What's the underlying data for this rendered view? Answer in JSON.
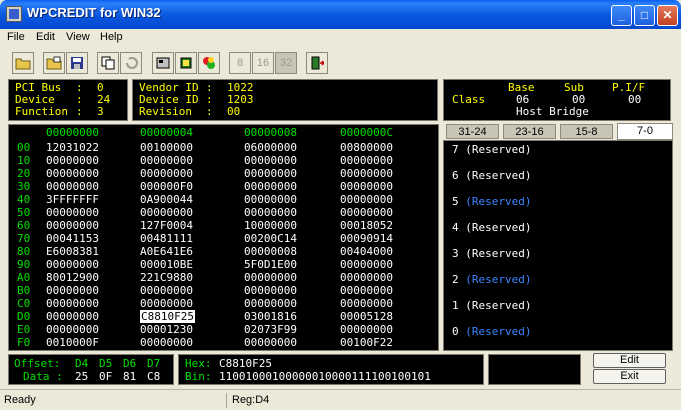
{
  "window": {
    "title": "WPCREDIT for WIN32",
    "buttons": [
      "_",
      "□",
      "✕"
    ]
  },
  "menu": [
    "File",
    "Edit",
    "View",
    "Help"
  ],
  "toolbar": {
    "bits": [
      "8",
      "16",
      "32"
    ]
  },
  "pci": {
    "bus_label": "PCI Bus",
    "bus": "0",
    "device_label": "Device",
    "device": "24",
    "function_label": "Function",
    "function": "3"
  },
  "vendor": {
    "vendor_label": "Vendor ID",
    "vendor": "1022",
    "device_label": "Device ID",
    "device": "1203",
    "revision_label": "Revision",
    "revision": "00"
  },
  "class": {
    "headers": [
      "Base",
      "Sub",
      "P.I/F"
    ],
    "label": "Class",
    "values": [
      "06",
      "00",
      "00"
    ],
    "description": "Host Bridge"
  },
  "grid": {
    "columns": [
      "00000000",
      "00000004",
      "00000008",
      "0000000C"
    ],
    "rows": [
      {
        "offset": "00",
        "cells": [
          "12031022",
          "00100000",
          "06000000",
          "00800000"
        ]
      },
      {
        "offset": "10",
        "cells": [
          "00000000",
          "00000000",
          "00000000",
          "00000000"
        ]
      },
      {
        "offset": "20",
        "cells": [
          "00000000",
          "00000000",
          "00000000",
          "00000000"
        ]
      },
      {
        "offset": "30",
        "cells": [
          "00000000",
          "000000F0",
          "00000000",
          "00000000"
        ]
      },
      {
        "offset": "40",
        "cells": [
          "3FFFFFFF",
          "0A900044",
          "00000000",
          "00000000"
        ]
      },
      {
        "offset": "50",
        "cells": [
          "00000000",
          "00000000",
          "00000000",
          "00000000"
        ]
      },
      {
        "offset": "60",
        "cells": [
          "00000000",
          "127F0004",
          "10000000",
          "00018052"
        ]
      },
      {
        "offset": "70",
        "cells": [
          "00041153",
          "00481111",
          "00200C14",
          "00090914"
        ]
      },
      {
        "offset": "80",
        "cells": [
          "E6008381",
          "A0E641E6",
          "00000008",
          "00404000"
        ]
      },
      {
        "offset": "90",
        "cells": [
          "00000000",
          "000010BE",
          "5F0D1E00",
          "00000000"
        ]
      },
      {
        "offset": "A0",
        "cells": [
          "80012900",
          "221C9880",
          "00000000",
          "00000000"
        ]
      },
      {
        "offset": "B0",
        "cells": [
          "00000000",
          "00000000",
          "00000000",
          "00000000"
        ]
      },
      {
        "offset": "C0",
        "cells": [
          "00000000",
          "00000000",
          "00000000",
          "00000000"
        ]
      },
      {
        "offset": "D0",
        "cells": [
          "00000000",
          "C8810F25",
          "03001816",
          "00005128"
        ]
      },
      {
        "offset": "E0",
        "cells": [
          "00000000",
          "00001230",
          "02073F99",
          "00000000"
        ]
      },
      {
        "offset": "F0",
        "cells": [
          "0010000F",
          "00000000",
          "00000000",
          "00100F22"
        ]
      }
    ],
    "selected": {
      "row": 13,
      "col": 1
    }
  },
  "bit_tabs": [
    "31-24",
    "23-16",
    "15-8",
    "7-0"
  ],
  "bit_tab_active": "7-0",
  "bits": [
    {
      "num": "7",
      "label": "(Reserved)",
      "set": false
    },
    {
      "num": "6",
      "label": "(Reserved)",
      "set": false
    },
    {
      "num": "5",
      "label": "(Reserved)",
      "set": true
    },
    {
      "num": "4",
      "label": "(Reserved)",
      "set": false
    },
    {
      "num": "3",
      "label": "(Reserved)",
      "set": false
    },
    {
      "num": "2",
      "label": "(Reserved)",
      "set": true
    },
    {
      "num": "1",
      "label": "(Reserved)",
      "set": false
    },
    {
      "num": "0",
      "label": "(Reserved)",
      "set": true
    }
  ],
  "offset_panel": {
    "offset_label": "Offset:",
    "offsets": [
      "D4",
      "D5",
      "D6",
      "D7"
    ],
    "data_label": "Data :",
    "data": [
      "25",
      "0F",
      "81",
      "C8"
    ]
  },
  "value_panel": {
    "hex_label": "Hex:",
    "hex": "C8810F25",
    "bin_label": "Bin:",
    "bin": "11001000100000010000111100100101"
  },
  "side_buttons": {
    "edit": "Edit",
    "exit": "Exit"
  },
  "status": {
    "left": "Ready",
    "right": "Reg:D4"
  },
  "colors": {
    "title_blue": "#0a59e0",
    "panel_bg": "#000000",
    "label_yellow": "#ffff00",
    "value_white": "#ffffff",
    "header_green": "#00e000",
    "bit_set_blue": "#3b86ff"
  }
}
